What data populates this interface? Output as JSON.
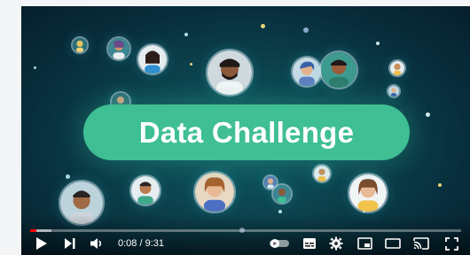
{
  "video": {
    "title_card": "Data Challenge",
    "current_time": "0:08",
    "separator": "/",
    "duration": "9:31",
    "progress_fraction": 0.014,
    "buffered_fraction": 0.05
  },
  "controls": {
    "play": "play-icon",
    "next": "next-icon",
    "volume": "volume-icon",
    "autoplay": "autoplay-toggle-icon",
    "subtitles": "subtitles-icon",
    "settings": "gear-icon",
    "miniplayer": "miniplayer-icon",
    "theater": "theater-mode-icon",
    "cast": "cast-icon",
    "fullscreen": "fullscreen-icon"
  },
  "colors": {
    "pill": "#3fbf93",
    "progress_played": "#ff0000",
    "background_center": "#0f5b63",
    "background_edge": "#061f2c"
  }
}
